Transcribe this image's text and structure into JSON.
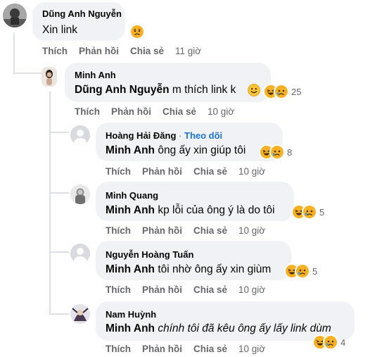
{
  "comments": [
    {
      "author": "Dũng Anh Nguyễn",
      "text": "Xin link",
      "actions": {
        "like": "Thích",
        "reply": "Phản hồi",
        "share": "Chia sẻ",
        "time": "11 giờ"
      },
      "reactions": {
        "icons": [
          "sad-reaction-icon"
        ],
        "count": ""
      }
    },
    {
      "author": "Minh Anh",
      "mention": "Dũng Anh Nguyễn",
      "text": " m thích link k ",
      "emoji": "smile-emoji-icon",
      "actions": {
        "like": "Thích",
        "reply": "Phản hồi",
        "share": "Chia sẻ",
        "time": "10 giờ"
      },
      "reactions": {
        "icons": [
          "haha-reaction-icon",
          "sad-reaction-icon"
        ],
        "count": "25"
      }
    },
    {
      "author": "Hoàng Hải Đăng",
      "separator": "·",
      "follow": "Theo dõi",
      "mention": "Minh Anh",
      "text": " ông ấy xin giúp tôi",
      "actions": {
        "like": "Thích",
        "reply": "Phản hồi",
        "share": "Chia sẻ",
        "time": "10 giờ"
      },
      "reactions": {
        "icons": [
          "haha-reaction-icon",
          "sad-reaction-icon"
        ],
        "count": "8"
      }
    },
    {
      "author": "Minh Quang",
      "mention": "Minh Anh",
      "text": " kp lỗi của ông ý là do tôi",
      "actions": {
        "like": "Thích",
        "reply": "Phản hồi",
        "share": "Chia sẻ",
        "time": "10 giờ"
      },
      "reactions": {
        "icons": [
          "haha-reaction-icon",
          "sad-reaction-icon"
        ],
        "count": "5"
      }
    },
    {
      "author": "Nguyễn Hoàng Tuấn",
      "mention": "Minh Anh",
      "text": " tôi nhờ ông ấy xin giùm",
      "actions": {
        "like": "Thích",
        "reply": "Phản hồi",
        "share": "Chia sẻ",
        "time": "10 giờ"
      },
      "reactions": {
        "icons": [
          "haha-reaction-icon",
          "sad-reaction-icon"
        ],
        "count": "5"
      }
    },
    {
      "author": "Nam Huỳnh",
      "mention": "Minh Anh",
      "text": " chính tôi đã kêu ông ấy lấy link dùm",
      "actions": {
        "like": "Thích",
        "reply": "Phản hồi",
        "share": "Chia sẻ",
        "time": "10 giờ"
      },
      "reactions": {
        "icons": [
          "haha-reaction-icon",
          "sad-reaction-icon"
        ],
        "count": "4"
      }
    }
  ],
  "colors": {
    "bubble": "#f0f2f5",
    "meta": "#65676b",
    "follow": "#1b74e4",
    "reaction_yellow": "#f7b125",
    "thread_line": "#dcdfe3"
  }
}
